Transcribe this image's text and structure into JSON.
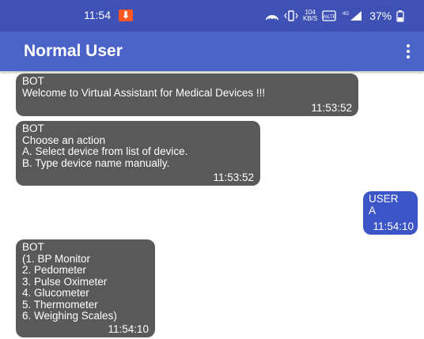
{
  "status_bar": {
    "time": "11:54",
    "download_badge": "⬇",
    "net_speed_value": "104",
    "net_speed_unit": "KB/S",
    "volte": "VoLTE",
    "signal": "4G",
    "battery": "37%"
  },
  "app_bar": {
    "title": "Normal User"
  },
  "messages": [
    {
      "sender": "BOT",
      "text": "Welcome to Virtual Assistant for Medical Devices !!!",
      "time": "11:53:52"
    },
    {
      "sender": "BOT",
      "text": "Choose an action\nA. Select device from list of device.\nB. Type device name manually.",
      "time": "11:53:52"
    },
    {
      "sender": "USER",
      "text": "A",
      "time": "11:54:10"
    },
    {
      "sender": "BOT",
      "text": "(1. BP Monitor\n2. Pedometer\n3. Pulse Oximeter\n4. Glucometer\n5. Thermometer\n6. Weighing Scales)",
      "time": "11:54:10"
    }
  ]
}
